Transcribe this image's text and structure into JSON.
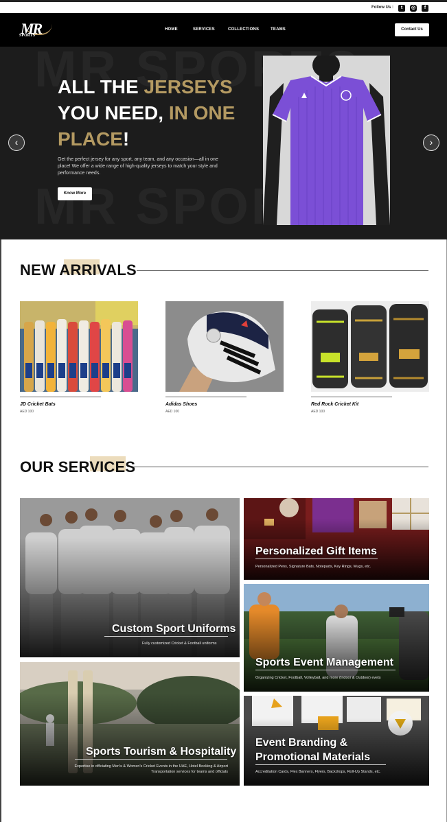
{
  "topbar": {
    "follow_label": "Follow Us :",
    "icons": [
      "twitter-icon",
      "instagram-icon",
      "facebook-icon"
    ]
  },
  "nav": {
    "logo_text": "MR",
    "logo_sub": "SPORTS",
    "links": [
      "HOME",
      "SERVICES",
      "COLLECTIONS",
      "TEAMS"
    ],
    "contact_label": "Contact Us"
  },
  "hero": {
    "watermark": "MR SPORTS",
    "title_part1": "ALL THE ",
    "title_gold1": "JERSEYS",
    "title_part2": "YOU NEED, ",
    "title_gold2": "IN ONE",
    "title_gold3": "PLACE",
    "title_end": "!",
    "description": "Get the perfect jersey for any sport, any team, and any occasion—all in one place! We offer a wide range of high-quality jerseys to match your style and performance needs.",
    "button_label": "Know More",
    "prev_icon": "‹",
    "next_icon": "›"
  },
  "new_arrivals": {
    "title": "NEW ARRIVALS",
    "products": [
      {
        "name": "JD Cricket Bats",
        "price": "AED 100"
      },
      {
        "name": "Adidas Shoes",
        "price": "AED 100"
      },
      {
        "name": "Red Rock Cricket Kit",
        "price": "AED 100"
      }
    ]
  },
  "services": {
    "title": "OUR SERVICES",
    "items": [
      {
        "title": "Custom Sport Uniforms",
        "desc": "Fully customized Cricket & Football uniforms"
      },
      {
        "title": "Personalized Gift Items",
        "desc": "Personalized Pens, Signature Bats, Notepads, Key Rings, Mugs, etc."
      },
      {
        "title": "Sports Event Management",
        "desc": "Organizing Cricket, Football, Volleyball, and more (Indoor & Outdoor) evets"
      },
      {
        "title": "Sports Tourism & Hospitality",
        "desc": "Expertise in officiating Men's & Women's Cricket Events in the UAE, Hotel Booking & Airport Transportation services for teams and officials"
      },
      {
        "title_line1": "Event Branding &",
        "title_line2": "Promotional Materials",
        "desc": "Accreditation Cards, Flex Banners, Flyers, Backdrops, Roll-Up Stands, etc."
      }
    ]
  },
  "colors": {
    "gold": "#b49a62",
    "hero_bg": "#1c1c1c",
    "nav_bg": "#000000",
    "jersey": "#7b4fd6"
  }
}
